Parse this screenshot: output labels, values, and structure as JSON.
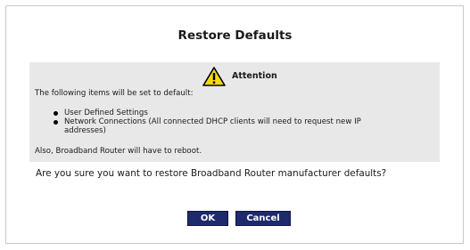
{
  "dialog": {
    "title": "Restore Defaults",
    "attention_label": "Attention",
    "intro": "The following items will be set to default:",
    "items": [
      "User Defined Settings",
      "Network Connections (All connected DHCP clients will need to request new IP",
      "addresses)"
    ],
    "reboot_note": "Also, Broadband Router will have to reboot.",
    "confirm_question": "Are you sure you want to restore Broadband Router manufacturer defaults?",
    "ok_label": "OK",
    "cancel_label": "Cancel"
  },
  "colors": {
    "panel_bg": "#e8e8e8",
    "button_bg": "#1e2a6b",
    "warning_yellow": "#f5d90a"
  },
  "icons": {
    "attention": "warning-triangle-icon"
  }
}
